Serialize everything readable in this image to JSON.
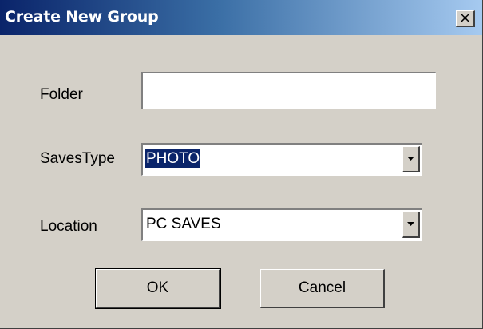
{
  "window": {
    "title": "Create New Group",
    "close_label": "×"
  },
  "form": {
    "folder": {
      "label": "Folder",
      "value": ""
    },
    "saves_type": {
      "label": "SavesType",
      "value": "PHOTO"
    },
    "location": {
      "label": "Location",
      "value": "PC SAVES"
    }
  },
  "buttons": {
    "ok": "OK",
    "cancel": "Cancel"
  },
  "colors": {
    "titlebar_start": "#0a246a",
    "titlebar_end": "#a6caf0",
    "dialog_bg": "#d4d0c8",
    "selection": "#0a246a"
  }
}
